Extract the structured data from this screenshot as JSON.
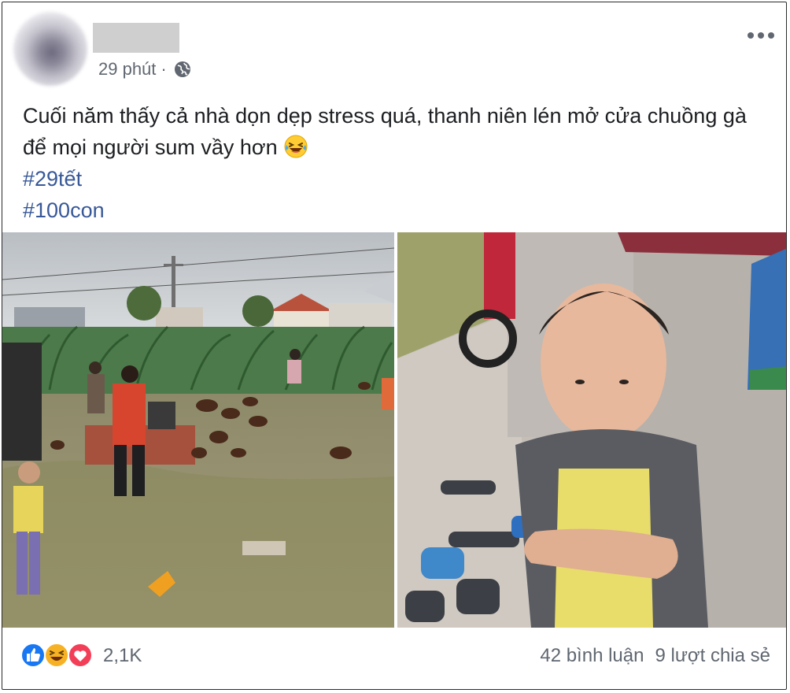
{
  "post": {
    "author_name": "",
    "time": "29 phút",
    "separator": "·",
    "body_line1": "Cuối năm thấy cả nhà dọn dẹp stress quá, thanh niên lén mở cửa chuồng gà để mọi người sum vầy hơn",
    "hashtags": [
      "#29tết",
      "#100con"
    ]
  },
  "icons": {
    "privacy": "globe-icon",
    "more": "more-options-icon",
    "emoji": "laughing-tears-emoji",
    "reactions": [
      "like-reaction-icon",
      "haha-reaction-icon",
      "love-reaction-icon"
    ]
  },
  "footer": {
    "reaction_count": "2,1K",
    "comments": "42 bình luận",
    "shares": "9 lượt chia sẻ"
  },
  "colors": {
    "link": "#385898",
    "meta": "#606770",
    "like": "#1877f2",
    "love": "#f33e58",
    "haha": "#f7b125"
  }
}
